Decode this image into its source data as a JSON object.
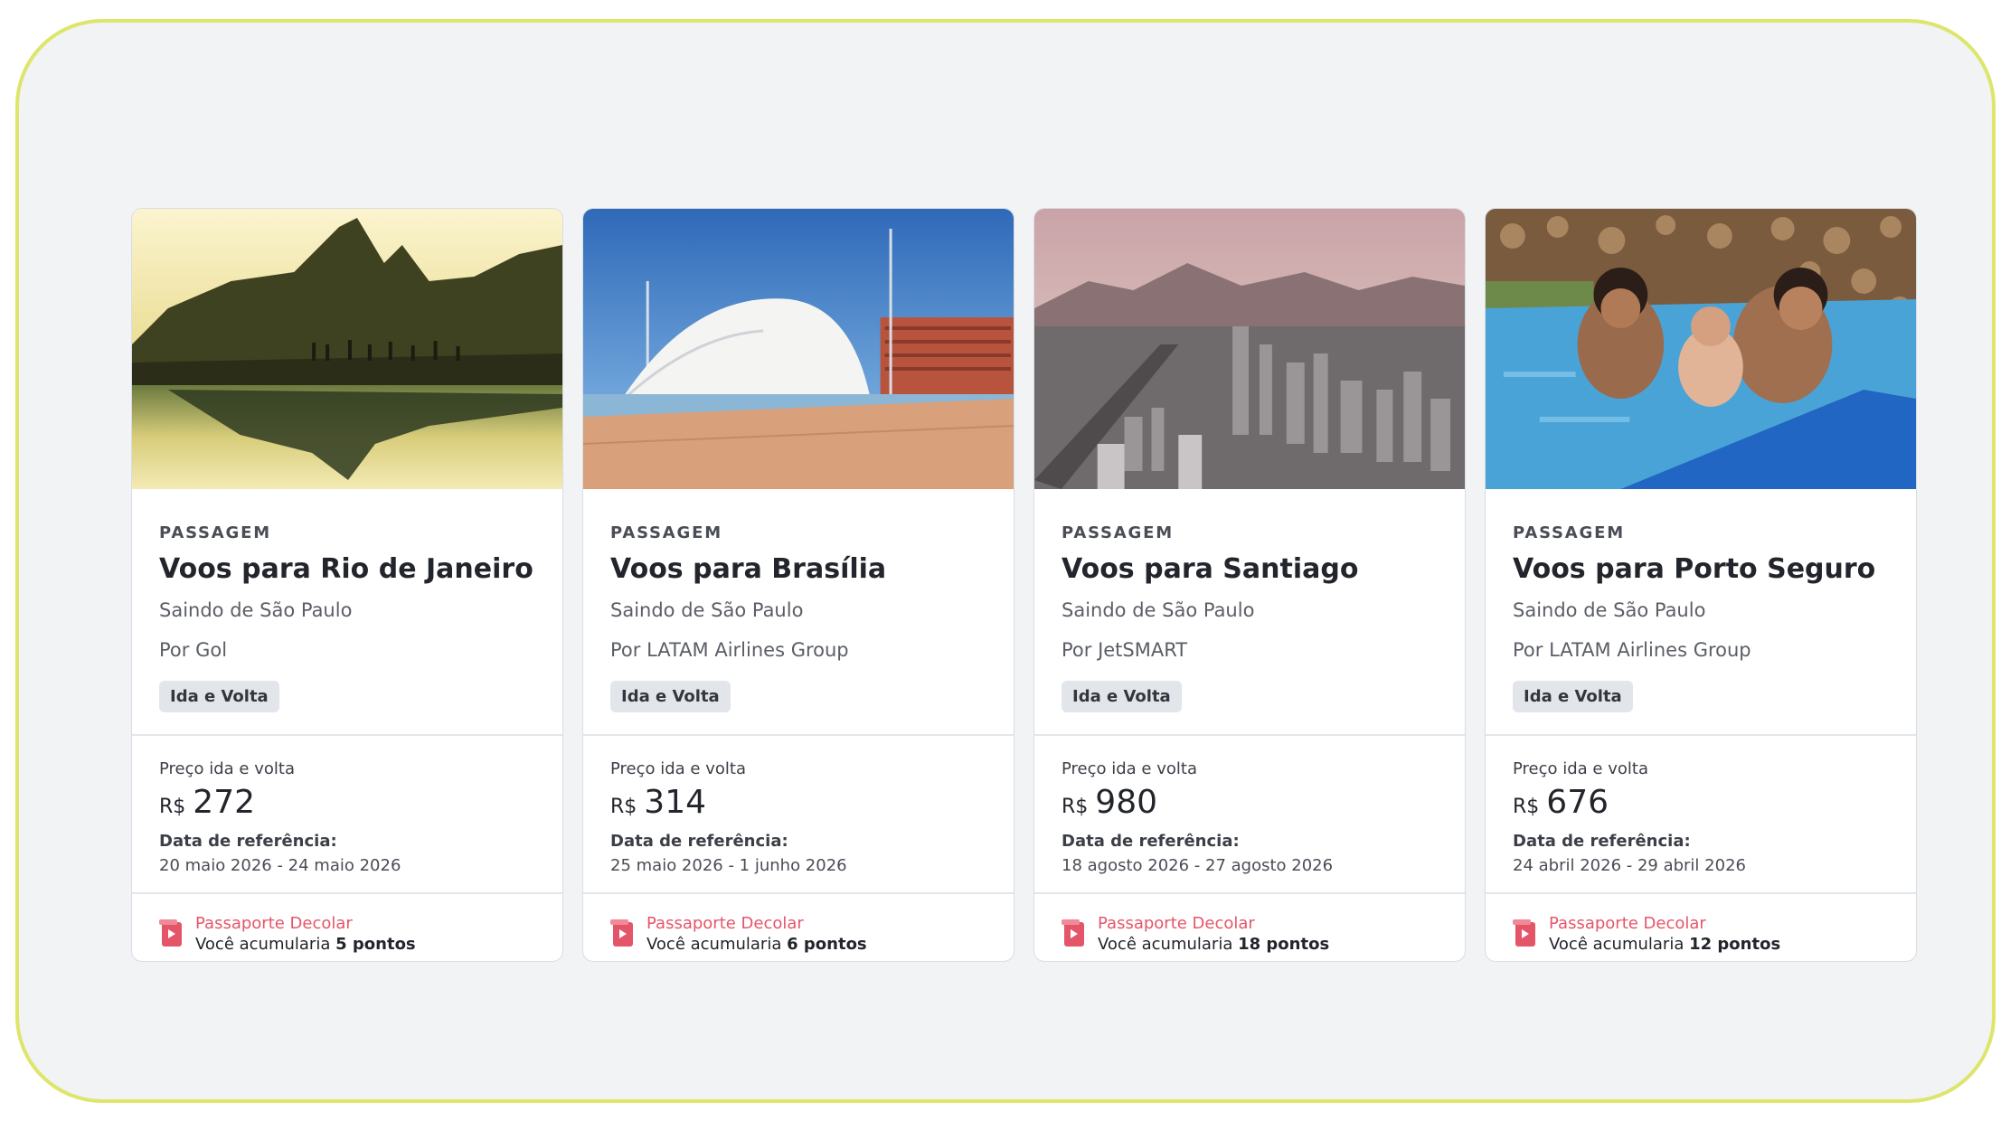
{
  "cards": [
    {
      "category": "PASSAGEM",
      "title": "Voos para Rio de Janeiro",
      "origin": "Saindo de São Paulo",
      "airline": "Por Gol",
      "trip_type": "Ida e Volta",
      "price_label": "Preço ida e volta",
      "currency": "R$",
      "price": "272",
      "ref_label": "Data de referência:",
      "ref_dates": "20 maio 2026 - 24 maio 2026",
      "program": "Passaporte Decolar",
      "points_prefix": "Você acumularia",
      "points": "5 pontos"
    },
    {
      "category": "PASSAGEM",
      "title": "Voos para Brasília",
      "origin": "Saindo de São Paulo",
      "airline": "Por LATAM Airlines Group",
      "trip_type": "Ida e Volta",
      "price_label": "Preço ida e volta",
      "currency": "R$",
      "price": "314",
      "ref_label": "Data de referência:",
      "ref_dates": "25 maio 2026 - 1 junho 2026",
      "program": "Passaporte Decolar",
      "points_prefix": "Você acumularia",
      "points": "6 pontos"
    },
    {
      "category": "PASSAGEM",
      "title": "Voos para Santiago",
      "origin": "Saindo de São Paulo",
      "airline": "Por JetSMART",
      "trip_type": "Ida e Volta",
      "price_label": "Preço ida e volta",
      "currency": "R$",
      "price": "980",
      "ref_label": "Data de referência:",
      "ref_dates": "18 agosto 2026 - 27 agosto 2026",
      "program": "Passaporte Decolar",
      "points_prefix": "Você acumularia",
      "points": "18 pontos"
    },
    {
      "category": "PASSAGEM",
      "title": "Voos para Porto Seguro",
      "origin": "Saindo de São Paulo",
      "airline": "Por LATAM Airlines Group",
      "trip_type": "Ida e Volta",
      "price_label": "Preço ida e volta",
      "currency": "R$",
      "price": "676",
      "ref_label": "Data de referência:",
      "ref_dates": "24 abril 2026 - 29 abril 2026",
      "program": "Passaporte Decolar",
      "points_prefix": "Você acumularia",
      "points": "12 pontos"
    }
  ],
  "colors": {
    "frame_border": "#dde66a",
    "background": "#f1f3f5",
    "loyalty_accent": "#e5556a",
    "badge_bg": "#e2e5ea"
  },
  "icons": {
    "loyalty": "passport-icon"
  }
}
